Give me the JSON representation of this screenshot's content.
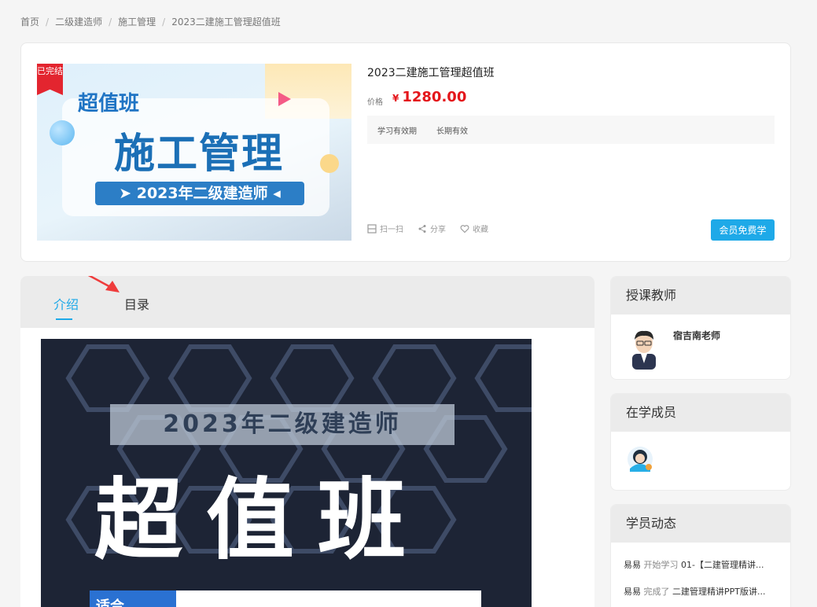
{
  "breadcrumb": [
    "首页",
    "二级建造师",
    "施工管理",
    "2023二建施工管理超值班"
  ],
  "course": {
    "ribbon": "已完结",
    "cover": {
      "tag": "超值班",
      "subject": "施工管理",
      "year_line": "➤ 2023年二级建造师 ◂"
    },
    "title": "2023二建施工管理超值班",
    "price_label": "价格",
    "currency": "¥",
    "price": "1280.00",
    "validity_label": "学习有效期",
    "validity_value": "长期有效",
    "actions": {
      "scan": "扫一扫",
      "share": "分享",
      "favorite": "收藏"
    },
    "member_button": "会员免费学"
  },
  "tabs": [
    {
      "label": "介绍",
      "active": true
    },
    {
      "label": "目录",
      "active": false
    }
  ],
  "intro_image": {
    "band": "2023年二级建造师",
    "big": "超值班",
    "bottom_tag": "适合"
  },
  "sidebar": {
    "teacher": {
      "title": "授课教师",
      "name": "宿吉南老师"
    },
    "members": {
      "title": "在学成员"
    },
    "activity": {
      "title": "学员动态",
      "items": [
        {
          "user": "易易",
          "verb": "开始学习",
          "target": "01-【二建管理精讲..."
        },
        {
          "user": "易易",
          "verb": "完成了",
          "target": "二建管理精讲PPT版讲..."
        }
      ]
    }
  },
  "colors": {
    "accent": "#1ea9e8",
    "price": "#e4161b",
    "ribbon": "#e3252f",
    "annotation_arrow": "#ef3c3c"
  }
}
